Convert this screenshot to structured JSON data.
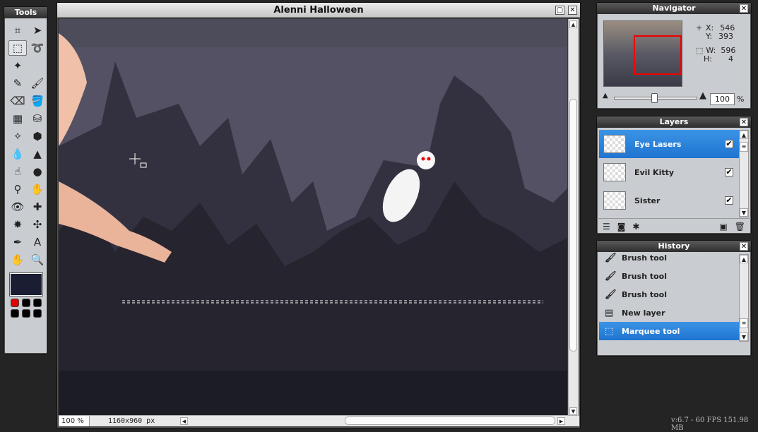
{
  "tools_panel": {
    "title": "Tools",
    "tools": [
      {
        "name": "crop-tool-icon",
        "glyph": "⌗"
      },
      {
        "name": "move-tool-icon",
        "glyph": "➤"
      },
      {
        "name": "marquee-tool-icon",
        "glyph": "⬚"
      },
      {
        "name": "lasso-tool-icon",
        "glyph": "➰"
      },
      {
        "name": "magic-wand-tool-icon",
        "glyph": "✦"
      },
      {
        "name": "blank-slot",
        "glyph": ""
      },
      {
        "name": "pencil-tool-icon",
        "glyph": "✎"
      },
      {
        "name": "brush-tool-icon",
        "glyph": "🖌"
      },
      {
        "name": "eraser-tool-icon",
        "glyph": "⌫"
      },
      {
        "name": "paint-bucket-tool-icon",
        "glyph": "🪣"
      },
      {
        "name": "gradient-tool-icon",
        "glyph": "▦"
      },
      {
        "name": "stamp-tool-icon",
        "glyph": "⛁"
      },
      {
        "name": "color-replace-tool-icon",
        "glyph": "✧"
      },
      {
        "name": "drawing-tool-icon",
        "glyph": "⬢"
      },
      {
        "name": "blur-tool-icon",
        "glyph": "💧"
      },
      {
        "name": "sharpen-tool-icon",
        "glyph": "▲"
      },
      {
        "name": "smudge-tool-icon",
        "glyph": "☝"
      },
      {
        "name": "sponge-tool-icon",
        "glyph": "●"
      },
      {
        "name": "dodge-tool-icon",
        "glyph": "⚲"
      },
      {
        "name": "burn-tool-icon",
        "glyph": "✋"
      },
      {
        "name": "red-eye-tool-icon",
        "glyph": "👁"
      },
      {
        "name": "spot-heal-tool-icon",
        "glyph": "✚"
      },
      {
        "name": "bloat-tool-icon",
        "glyph": "✸"
      },
      {
        "name": "pinch-tool-icon",
        "glyph": "✣"
      },
      {
        "name": "color-picker-tool-icon",
        "glyph": "✒"
      },
      {
        "name": "type-tool-icon",
        "glyph": "A"
      },
      {
        "name": "hand-tool-icon",
        "glyph": "✋"
      },
      {
        "name": "zoom-tool-icon",
        "glyph": "🔍"
      }
    ],
    "primary_color": "#1b1d33",
    "swatches": [
      "#e00000",
      "#000000",
      "#000000",
      "#000000",
      "#000000",
      "#000000"
    ]
  },
  "image_window": {
    "title": "Alenni Halloween",
    "zoom": "100 %",
    "dimensions": "1160x960 px"
  },
  "navigator": {
    "title": "Navigator",
    "x_label": "X:",
    "x_value": "546",
    "y_label": "Y:",
    "y_value": "393",
    "w_label": "W:",
    "w_value": "596",
    "h_label": "H:",
    "h_value": "4",
    "zoom_value": "100",
    "zoom_unit": "%"
  },
  "layers": {
    "title": "Layers",
    "items": [
      {
        "label": "Eye Lasers",
        "visible": true,
        "selected": true
      },
      {
        "label": "Evil Kitty",
        "visible": true,
        "selected": false
      },
      {
        "label": "Sister",
        "visible": true,
        "selected": false
      }
    ]
  },
  "history": {
    "title": "History",
    "items": [
      {
        "label": "Brush tool",
        "icon": "brush-icon"
      },
      {
        "label": "Brush tool",
        "icon": "brush-icon"
      },
      {
        "label": "Brush tool",
        "icon": "brush-icon"
      },
      {
        "label": "New layer",
        "icon": "new-layer-icon"
      },
      {
        "label": "Marquee tool",
        "icon": "marquee-icon"
      }
    ]
  },
  "status": {
    "version": "v:6.7 - 60 FPS 151.98 MB"
  }
}
